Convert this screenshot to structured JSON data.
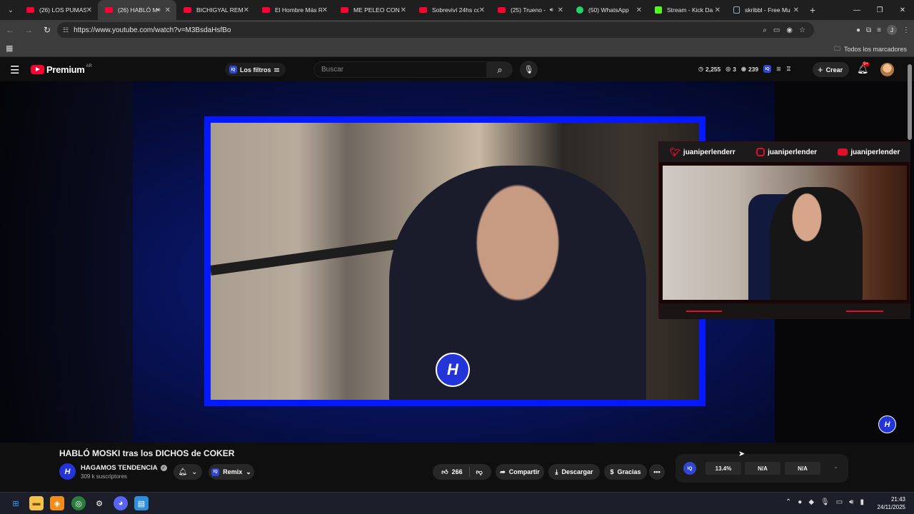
{
  "browser": {
    "tabs": [
      {
        "title": "(26) LOS PUMAS",
        "favicon": "youtube-icon",
        "audio": false
      },
      {
        "title": "(26) HABLÓ M",
        "favicon": "youtube-icon",
        "audio": true,
        "active": true
      },
      {
        "title": "BICHIGYAL REMIX",
        "favicon": "youtube-icon",
        "audio": false
      },
      {
        "title": "El Hombre Más R",
        "favicon": "youtube-icon",
        "audio": false
      },
      {
        "title": "ME PELEO CON L",
        "favicon": "youtube-icon",
        "audio": false
      },
      {
        "title": "Sobreviví 24hs co",
        "favicon": "youtube-icon",
        "audio": false
      },
      {
        "title": "(25) Trueno -",
        "favicon": "youtube-icon",
        "audio": true
      },
      {
        "title": "(50) WhatsApp",
        "favicon": "whatsapp-icon",
        "audio": false
      },
      {
        "title": "Stream - Kick Da",
        "favicon": "kick-icon",
        "audio": false
      },
      {
        "title": "skribbl - Free Mu",
        "favicon": "skribbl-icon",
        "audio": false
      }
    ],
    "url": "https://www.youtube.com/watch?v=M3BsdaHsfBo",
    "bookmarks_all": "Todos los marcadores",
    "profile_initial": "J"
  },
  "masthead": {
    "logo_text": "Premium",
    "country": "AR",
    "filters_label": "Los filtros",
    "iq_label": "IQ",
    "search_placeholder": "Buscar",
    "stats": {
      "views": "2,255",
      "second": "3",
      "third": "239"
    },
    "create_label": "Crear",
    "notifications": "9+"
  },
  "player": {
    "socials": {
      "twitter": "juaniperlenderr",
      "instagram": "juaniperlender",
      "youtube": "juaniperlender"
    },
    "overlay_logo": "H"
  },
  "video": {
    "title": "HABLÓ MOSKI tras los DICHOS de COKER",
    "channel": "HAGAMOS TENDENCIA",
    "subscribers": "309 k suscriptores",
    "remix_label": "Remix",
    "likes": "266",
    "share_label": "Compartir",
    "download_label": "Descargar",
    "thanks_label": "Gracias"
  },
  "rating": {
    "label": "IQ",
    "values": [
      "13.4%",
      "N/A",
      "N/A"
    ]
  },
  "taskbar": {
    "time": "21:43",
    "date": "24/11/2025"
  },
  "colors": {
    "youtube_red": "#ff0033",
    "frame_blue": "#0519ff",
    "overlay_red": "#e0102b",
    "channel_blue": "#2335d8"
  }
}
